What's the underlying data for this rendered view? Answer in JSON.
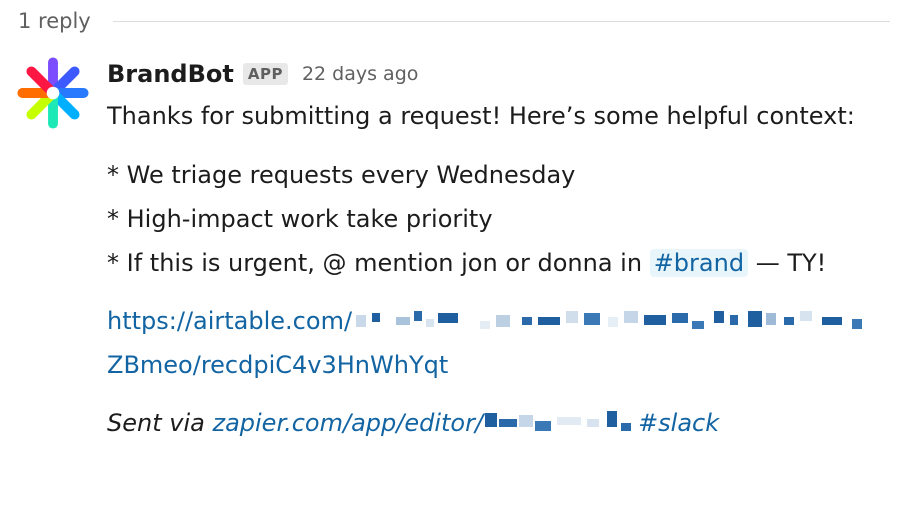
{
  "thread": {
    "reply_count": "1 reply"
  },
  "message": {
    "sender": "BrandBot",
    "badge": "APP",
    "timestamp": "22 days ago",
    "intro": "Thanks for submitting a request! Here’s some helpful context:",
    "bullets": {
      "line1": "* We triage requests every Wednesday",
      "line2": "* High-impact work take priority",
      "line3_pre": "* If this is urgent, @ mention jon or donna in ",
      "channel": "#brand",
      "line3_post": " — TY!"
    },
    "airtable_link": {
      "prefix": "https://airtable.com/",
      "suffix": "ZBmeo/recdpiC4v3HnWhYqt"
    },
    "sent_via": {
      "label": "Sent via ",
      "link_prefix": "zapier.com/app/editor/",
      "link_suffix": "#slack"
    }
  },
  "colors": {
    "link": "#1264a3",
    "channel_bg": "#e8f5fa",
    "muted_text": "#616061",
    "badge_bg": "#e8e8e8"
  },
  "icons": {
    "avatar": "zapier-asterisk-logo"
  }
}
